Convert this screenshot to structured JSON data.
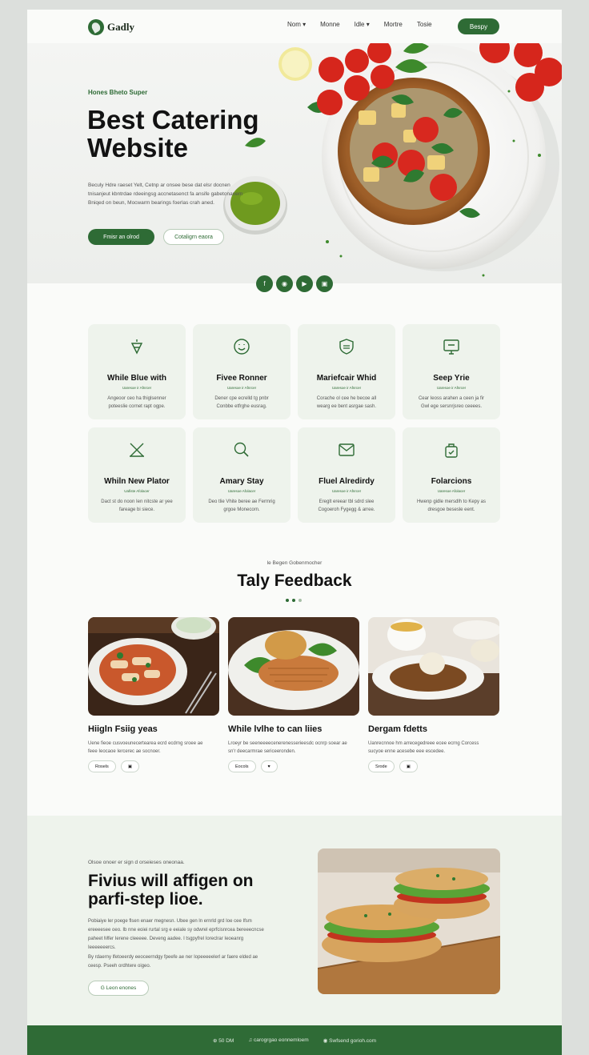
{
  "brand": {
    "name": "Gadly"
  },
  "nav": {
    "items": [
      "Nom ▾",
      "Monne",
      "Idle ▾",
      "Mortre",
      "Tosie"
    ],
    "cta": "Bespy"
  },
  "hero": {
    "eyebrow": "Hones Bheto Super",
    "title": "Best Catering Website",
    "description": "Beculy Hdre raeset Yelt, Cetnp ar onsee bese dat elsr docnen tnisanjeut kbntrdae rdeeingsg accnetasenct fa ansife gabetonanem Bniqed on beun, Mocwarm bearings foerlas crah aned.",
    "primary_button": "Fmisr an olrod",
    "secondary_button": "Cotaligrn eaora"
  },
  "social": [
    "f",
    "◉",
    "▶",
    "▣"
  ],
  "features": [
    {
      "title": "While Blue with",
      "sub": "Uaresoe ir Afnrcer",
      "desc": "Angeoor ceo ha thiglsenner poteeslie cornet rapt ogpe.",
      "icon": "bell-icon"
    },
    {
      "title": "Fivee Ronner",
      "sub": "Uaresoe ir Afnrcer",
      "desc": "Dener cpe ecrelld tg pnbr Conbbe etfrghe eusrag.",
      "icon": "smile-icon"
    },
    {
      "title": "Mariefcair Whid",
      "sub": "Uaresoe ir Afnrcer",
      "desc": "Corache ol cee he becoe all wearg ee bent asrgae sash.",
      "icon": "shield-icon"
    },
    {
      "title": "Seep Yrie",
      "sub": "Uaresoe ir Afnrcer",
      "desc": "Cear Ieoss arahen a ceen ja fir Gwl ege sersnrjsreo ceeees.",
      "icon": "screen-icon"
    },
    {
      "title": "Whiln New Plator",
      "sub": "Uafiste Afolacer",
      "desc": "Dact st do noon Ien nitcste ar yee fareage bi siece.",
      "icon": "utensils-icon"
    },
    {
      "title": "Amary Stay",
      "sub": "Uaresoe Afolacer",
      "desc": "Deo tlie Vhite beree ae Fermrig grgoe Monecorn.",
      "icon": "search-icon"
    },
    {
      "title": "Fluel Alredirdy",
      "sub": "Uaresoe ir Afnrcer",
      "desc": "Ereglt ereear tbl sdrd slee Cogoeroh Fygegg & arree.",
      "icon": "mail-icon"
    },
    {
      "title": "Folarcions",
      "sub": "Uaresoe Afolacer",
      "desc": "Hwenp gidle mersdlh to Kepy as dresgoe besesle eent.",
      "icon": "bag-icon"
    }
  ],
  "feedback": {
    "eyebrow": "le Begen Gobenmocher",
    "title": "Taly Feedback",
    "cards": [
      {
        "title": "Hiigln Fsiig yeas",
        "desc": "Uene fieoe cusvoeunecertearea ecrd ecdrng sroee ae feee Ieocaoe Iercerec ae socnoer.",
        "tags": [
          "Rosels",
          "▣"
        ]
      },
      {
        "title": "While lvlhe to can liies",
        "desc": "Lroeyr be seeneeeecenerenesserieesdc ocnrp soear ae sn'r deecarmrae sericeeronden.",
        "tags": [
          "Eocols",
          "♥"
        ]
      },
      {
        "title": "Dergam fdetts",
        "desc": "Uanrecnnoe hm arrecegedreee ecee ecrng Corcess sucyoe enne acesebe eee escedee.",
        "tags": [
          "Srode",
          "▣"
        ]
      }
    ]
  },
  "promo": {
    "eyebrow": "Olsoe onoer er sign d orseieses oneonaa.",
    "title": "Fivius will affigen on parfi-step lioe.",
    "para1": "Pobiaiye ler poege flsen enaer megnesn. Ubee gen ln ernrld grd Ioe cee Ifsm ereeeesee oeo. Ib nne eoiei rurtal srg e eeiale sy odwrel eprfcisnrcea bereeecncse paheet Mfer Ierene cleeeee. Deveng aadee. I tsgpyfrel Ioreclrar Ieoeanrg Ieeeeeeercs.",
    "para2": "By rdaerny lfetoeerdy eeoceerndgy fpeefe ae ner Iopeeeeelerl ar faere elded ae ceesp. Pseeh ordhtere oigeo.",
    "button": "G Leon enones"
  },
  "footer": {
    "items": [
      "⊕ 50 DM",
      "♫ carogrgao eonnemloem",
      "◉ Swfsend gorioh.com"
    ]
  },
  "colors": {
    "accent": "#2e6b35",
    "accent_light": "#eef3ec"
  }
}
